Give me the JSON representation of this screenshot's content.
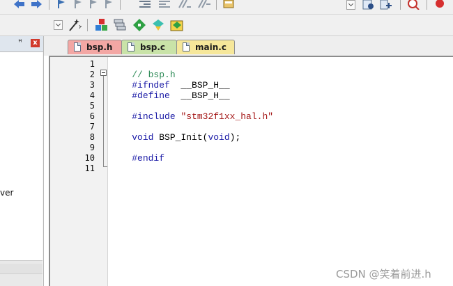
{
  "toolbar_top": {
    "icons": [
      "arrow-left-icon",
      "arrow-right-icon",
      "bookmark-icon",
      "bookmark-prev-icon",
      "bookmark-next-icon",
      "bookmark-clear-icon",
      "indent-icon",
      "unindent-icon",
      "comment-icon",
      "uncomment-icon",
      "find-in-files-icon",
      "dropdown-icon",
      "debug-icon",
      "insert-icon",
      "search-icon",
      "breakpoint-icon"
    ]
  },
  "toolbar_bottom": {
    "icons": [
      "dropdown-icon",
      "magic-wand-icon",
      "manage-components-icon",
      "build-target-icon",
      "pack-installer-icon",
      "select-device-icon",
      "software-packs-icon"
    ]
  },
  "left_panel": {
    "pin_glyph": "ꟸ",
    "close_glyph": "x",
    "visible_text": "ver"
  },
  "tabs": [
    {
      "label": "bsp.h",
      "color": "#f3a7a4",
      "active": true
    },
    {
      "label": "bsp.c",
      "color": "#c9e3a8",
      "active": false
    },
    {
      "label": "main.c",
      "color": "#f6e79a",
      "active": false
    }
  ],
  "editor": {
    "line_numbers": [
      "1",
      "2",
      "3",
      "4",
      "5",
      "6",
      "7",
      "8",
      "9",
      "10",
      "11"
    ],
    "lines": [
      {
        "parts": [
          {
            "text": "// bsp.h",
            "kind": "comment"
          }
        ]
      },
      {
        "parts": [
          {
            "text": "#ifndef",
            "kind": "kw"
          },
          {
            "text": "  __BSP_H__",
            "kind": "plain"
          }
        ]
      },
      {
        "parts": [
          {
            "text": "#define",
            "kind": "kw"
          },
          {
            "text": "  __BSP_H__",
            "kind": "plain"
          }
        ]
      },
      {
        "parts": []
      },
      {
        "parts": [
          {
            "text": "#include ",
            "kind": "kw"
          },
          {
            "text": "\"stm32f1xx_hal.h\"",
            "kind": "string"
          }
        ]
      },
      {
        "parts": []
      },
      {
        "parts": [
          {
            "text": "void",
            "kind": "kw"
          },
          {
            "text": " BSP_Init(",
            "kind": "plain"
          },
          {
            "text": "void",
            "kind": "kw"
          },
          {
            "text": ");",
            "kind": "plain"
          }
        ]
      },
      {
        "parts": []
      },
      {
        "parts": [
          {
            "text": "#endif",
            "kind": "kw"
          }
        ]
      },
      {
        "parts": []
      },
      {
        "parts": []
      }
    ]
  },
  "watermark": "CSDN @笑着前进.h"
}
